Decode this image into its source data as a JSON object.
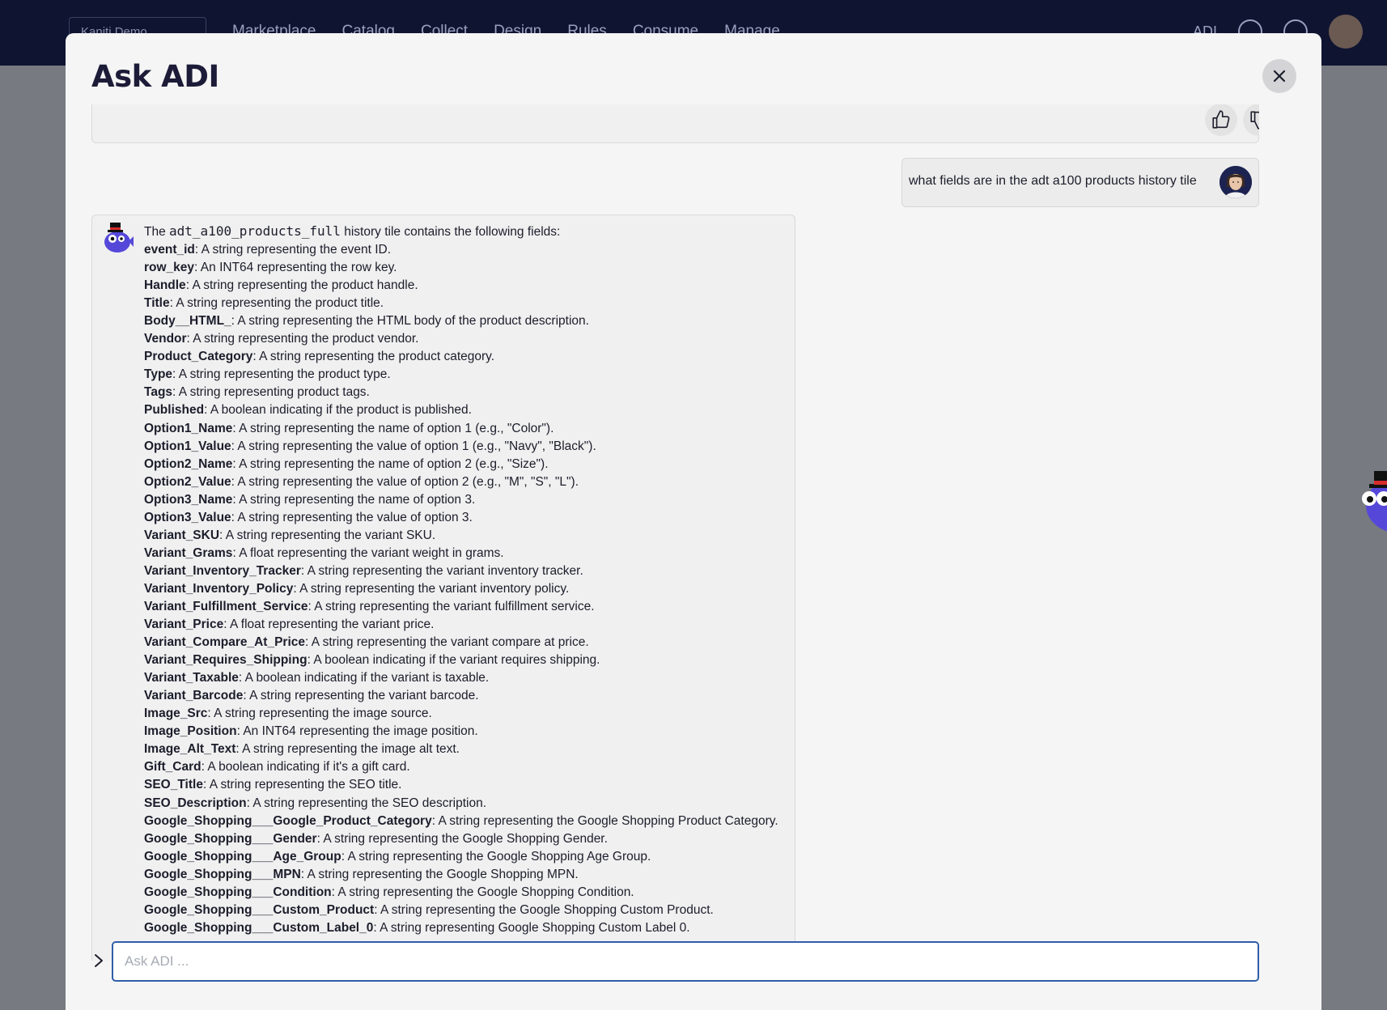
{
  "background_app": {
    "org_selector": "Kaniti Demo",
    "nav": [
      "Marketplace",
      "Catalog",
      "Collect",
      "Design",
      "Rules",
      "Consume",
      "Manage"
    ],
    "adi_label": "ADI"
  },
  "modal": {
    "title": "Ask ADI",
    "close_icon": "close-icon"
  },
  "feedback": {
    "thumbs_up_icon": "thumbs-up-icon",
    "thumbs_down_icon": "thumbs-down-icon"
  },
  "user_message": {
    "text": "what fields are in the adt a100 products history tile"
  },
  "bot_message": {
    "intro_before": "The ",
    "intro_code": "adt_a100_products_full",
    "intro_after": " history tile contains the following fields:",
    "fields": [
      {
        "name": "event_id",
        "desc": ": A string representing the event ID."
      },
      {
        "name": "row_key",
        "desc": ": An INT64 representing the row key."
      },
      {
        "name": "Handle",
        "desc": ": A string representing the product handle."
      },
      {
        "name": "Title",
        "desc": ": A string representing the product title."
      },
      {
        "name": "Body__HTML_",
        "desc": ": A string representing the HTML body of the product description."
      },
      {
        "name": "Vendor",
        "desc": ": A string representing the product vendor."
      },
      {
        "name": "Product_Category",
        "desc": ": A string representing the product category."
      },
      {
        "name": "Type",
        "desc": ": A string representing the product type."
      },
      {
        "name": "Tags",
        "desc": ": A string representing product tags."
      },
      {
        "name": "Published",
        "desc": ": A boolean indicating if the product is published."
      },
      {
        "name": "Option1_Name",
        "desc": ": A string representing the name of option 1 (e.g., \"Color\")."
      },
      {
        "name": "Option1_Value",
        "desc": ": A string representing the value of option 1 (e.g., \"Navy\", \"Black\")."
      },
      {
        "name": "Option2_Name",
        "desc": ": A string representing the name of option 2 (e.g., \"Size\")."
      },
      {
        "name": "Option2_Value",
        "desc": ": A string representing the value of option 2 (e.g., \"M\", \"S\", \"L\")."
      },
      {
        "name": "Option3_Name",
        "desc": ": A string representing the name of option 3."
      },
      {
        "name": "Option3_Value",
        "desc": ": A string representing the value of option 3."
      },
      {
        "name": "Variant_SKU",
        "desc": ": A string representing the variant SKU."
      },
      {
        "name": "Variant_Grams",
        "desc": ": A float representing the variant weight in grams."
      },
      {
        "name": "Variant_Inventory_Tracker",
        "desc": ": A string representing the variant inventory tracker."
      },
      {
        "name": "Variant_Inventory_Policy",
        "desc": ": A string representing the variant inventory policy."
      },
      {
        "name": "Variant_Fulfillment_Service",
        "desc": ": A string representing the variant fulfillment service."
      },
      {
        "name": "Variant_Price",
        "desc": ": A float representing the variant price."
      },
      {
        "name": "Variant_Compare_At_Price",
        "desc": ": A string representing the variant compare at price."
      },
      {
        "name": "Variant_Requires_Shipping",
        "desc": ": A boolean indicating if the variant requires shipping."
      },
      {
        "name": "Variant_Taxable",
        "desc": ": A boolean indicating if the variant is taxable."
      },
      {
        "name": "Variant_Barcode",
        "desc": ": A string representing the variant barcode."
      },
      {
        "name": "Image_Src",
        "desc": ": A string representing the image source."
      },
      {
        "name": "Image_Position",
        "desc": ": An INT64 representing the image position."
      },
      {
        "name": "Image_Alt_Text",
        "desc": ": A string representing the image alt text."
      },
      {
        "name": "Gift_Card",
        "desc": ": A boolean indicating if it's a gift card."
      },
      {
        "name": "SEO_Title",
        "desc": ": A string representing the SEO title."
      },
      {
        "name": "SEO_Description",
        "desc": ": A string representing the SEO description."
      },
      {
        "name": "Google_Shopping___Google_Product_Category",
        "desc": ": A string representing the Google Shopping Product Category."
      },
      {
        "name": "Google_Shopping___Gender",
        "desc": ": A string representing the Google Shopping Gender."
      },
      {
        "name": "Google_Shopping___Age_Group",
        "desc": ": A string representing the Google Shopping Age Group."
      },
      {
        "name": "Google_Shopping___MPN",
        "desc": ": A string representing the Google Shopping MPN."
      },
      {
        "name": "Google_Shopping___Condition",
        "desc": ": A string representing the Google Shopping Condition."
      },
      {
        "name": "Google_Shopping___Custom_Product",
        "desc": ": A string representing the Google Shopping Custom Product."
      },
      {
        "name": "Google_Shopping___Custom_Label_0",
        "desc": ": A string representing Google Shopping Custom Label 0."
      }
    ]
  },
  "input": {
    "placeholder": "Ask ADI ...",
    "value": "",
    "expand_icon": "chevron-right-icon"
  },
  "colors": {
    "topbar": "#0f1430",
    "modal_bg": "#f5f5f5",
    "input_border": "#2e5ea8",
    "title": "#1c1c38"
  }
}
